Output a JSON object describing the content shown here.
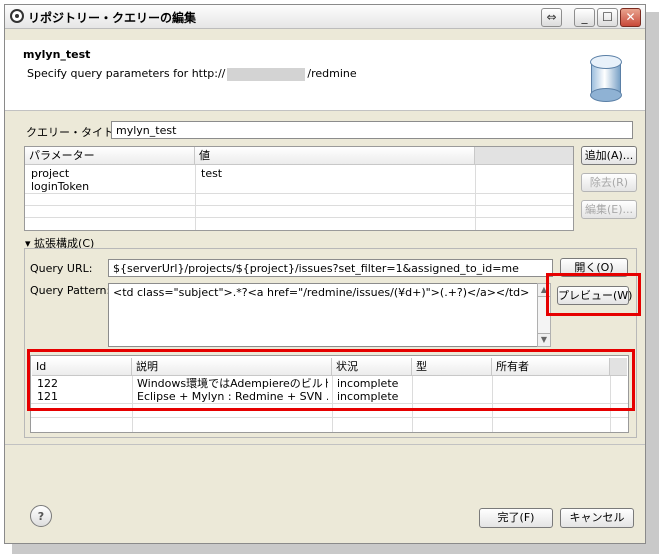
{
  "window": {
    "title": "リポジトリー・クエリーの編集",
    "controls": [
      "⇔",
      "_",
      "☐",
      "✕"
    ]
  },
  "header": {
    "name": "mylyn_test",
    "desc_prefix": "Specify query parameters for http://",
    "desc_suffix": "/redmine"
  },
  "query_title": {
    "label": "クエリー・タイトル:",
    "value": "mylyn_test"
  },
  "params_table": {
    "columns": [
      "パラメーター",
      "値"
    ],
    "rows": [
      {
        "param": "project",
        "value": "test"
      },
      {
        "param": "loginToken",
        "value": ""
      }
    ]
  },
  "side_buttons": {
    "add": "追加(A)...",
    "remove": "除去(R)",
    "edit": "編集(E)..."
  },
  "advanced": {
    "label": "拡張構成(C)"
  },
  "query_url": {
    "label": "Query URL:",
    "value": "${serverUrl}/projects/${project}/issues?set_filter=1&assigned_to_id=me",
    "open_button": "開く(O)"
  },
  "query_pattern": {
    "label": "Query Pattern:",
    "value": "<td class=\"subject\">.*?<a href=\"/redmine/issues/(¥d+)\">(.+?)</a></td>",
    "preview_button": "プレビュー(W)"
  },
  "results_table": {
    "columns": [
      "Id",
      "説明",
      "状況",
      "型",
      "所有者"
    ],
    "rows": [
      [
        "122",
        "Windows環境ではAdempiereのビルド...",
        "incomplete",
        "",
        ""
      ],
      [
        "121",
        "Eclipse + Mylyn : Redmine + SVN ...",
        "incomplete",
        "",
        ""
      ]
    ]
  },
  "footer": {
    "help": "?",
    "finish": "完了(F)",
    "cancel": "キャンセル"
  },
  "colors": {
    "highlight": "#e60000",
    "window_bg": "#ece9d8"
  }
}
